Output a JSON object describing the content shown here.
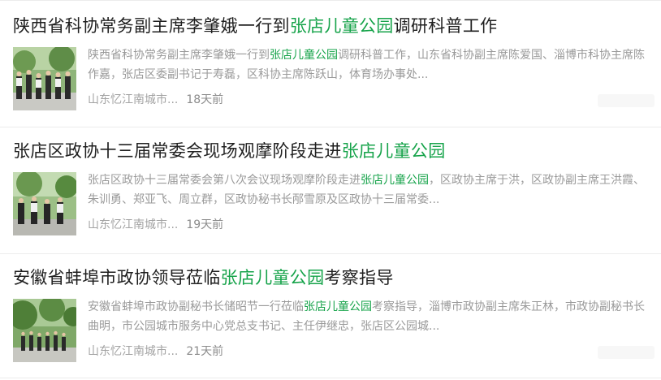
{
  "items": [
    {
      "title_pre": "陕西省科协常务副主席李肇娥一行到",
      "title_hl": "张店儿童公园",
      "title_post": "调研科普工作",
      "snippet_pre": "陕西省科协常务副主席李肇娥一行到",
      "snippet_hl": "张店儿童公园",
      "snippet_post": "调研科普工作，山东省科协副主席陈爱国、淄博市科协主席陈作嘉，张店区委副书记于寿磊，区科协主席陈跃山，体育场办事处...",
      "source": "山东忆江南城市...",
      "time": "18天前"
    },
    {
      "title_pre": "张店区政协十三届常委会现场观摩阶段走进",
      "title_hl": "张店儿童公园",
      "title_post": "",
      "snippet_pre": "张店区政协十三届常委会第八次会议现场观摩阶段走进",
      "snippet_hl": "张店儿童公园",
      "snippet_post": "，区政协主席于洪，区政协副主席王洪霞、朱训勇、郑亚飞、周立群，区政协秘书长邴雪原及区政协十三届常委...",
      "source": "山东忆江南城市...",
      "time": "19天前"
    },
    {
      "title_pre": "安徽省蚌埠市政协领导莅临",
      "title_hl": "张店儿童公园",
      "title_post": "考察指导",
      "snippet_pre": "安徽省蚌埠市政协副秘书长储昭节一行莅临",
      "snippet_hl": "张店儿童公园",
      "snippet_post": "考察指导，淄博市政协副主席朱正林，市政协副秘书长曲明，市公园城市服务中心党总支书记、主任伊继忠，张店区公园城...",
      "source": "山东忆江南城市...",
      "time": "21天前"
    }
  ]
}
